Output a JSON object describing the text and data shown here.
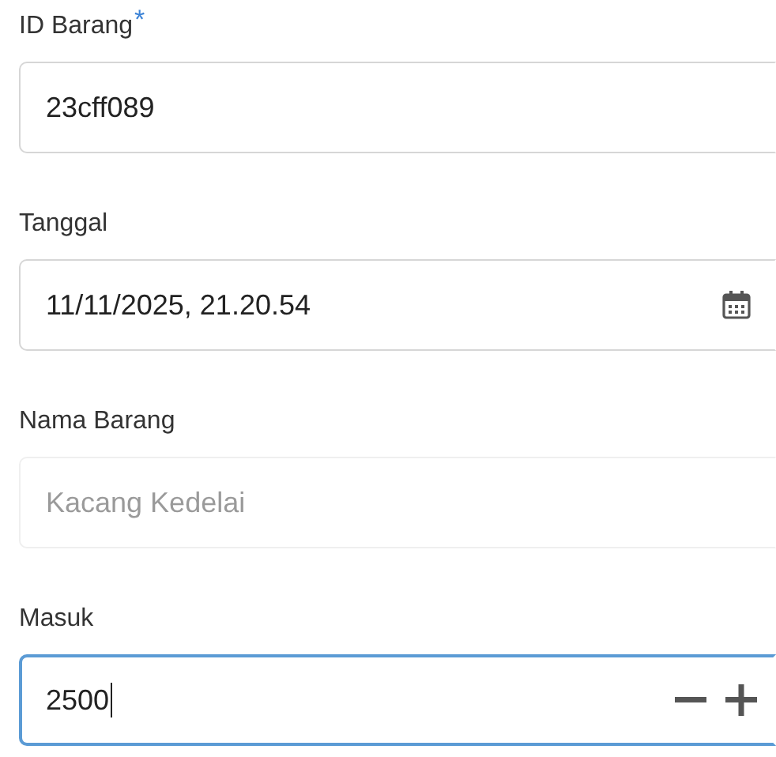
{
  "fields": [
    {
      "label": "ID Barang",
      "required_mark": "*",
      "kind": "text",
      "value": "23cff089",
      "disabled": false,
      "focused": false
    },
    {
      "label": "Tanggal",
      "kind": "datetime",
      "value": "11/11/2025, 21.20.54",
      "disabled": false,
      "focused": false
    },
    {
      "label": "Nama Barang",
      "kind": "text",
      "value": "Kacang Kedelai",
      "disabled": true,
      "focused": false
    },
    {
      "label": "Masuk",
      "kind": "number",
      "value": "2500",
      "disabled": false,
      "focused": true
    }
  ]
}
